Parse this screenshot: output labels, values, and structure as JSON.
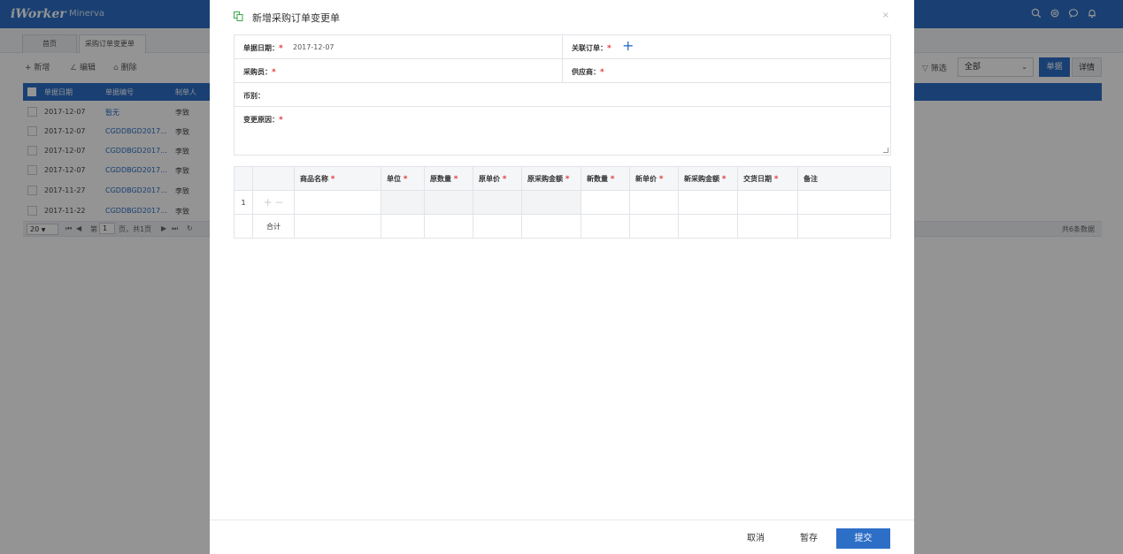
{
  "app": {
    "brand": "iWorker",
    "workspace": "Minerva"
  },
  "tabs": {
    "home": "首页",
    "active": "采购订单变更单",
    "close": "×"
  },
  "toolbar": {
    "add": "+ 新增",
    "edit": "编辑",
    "delete": "删除",
    "filter_label": "筛选",
    "filter_value": "全部",
    "view_list": "单据",
    "view_detail": "详情"
  },
  "grid": {
    "headers": [
      "单据日期",
      "单据编号",
      "制单人"
    ],
    "rows": [
      {
        "date": "2017-12-07",
        "no": "暂无",
        "user": "李致"
      },
      {
        "date": "2017-12-07",
        "no": "CGDDBGD2017...",
        "user": "李致"
      },
      {
        "date": "2017-12-07",
        "no": "CGDDBGD2017...",
        "user": "李致"
      },
      {
        "date": "2017-12-07",
        "no": "CGDDBGD2017...",
        "user": "李致"
      },
      {
        "date": "2017-11-27",
        "no": "CGDDBGD2017...",
        "user": "李致"
      },
      {
        "date": "2017-11-22",
        "no": "CGDDBGD2017...",
        "user": "李致"
      }
    ],
    "pager": {
      "size": "20",
      "page_prefix": "第",
      "page": "1",
      "page_suffix": "页，共1页",
      "total": "共6条数据"
    }
  },
  "modal": {
    "title": "新增采购订单变更单",
    "close": "×",
    "fields": {
      "date_label": "单据日期：",
      "date_value": "2017-12-07",
      "order_label": "关联订单：",
      "buyer_label": "采购员：",
      "supplier_label": "供应商：",
      "currency_label": "币别：",
      "reason_label": "变更原因："
    },
    "required_mark": "*",
    "table": {
      "headers": [
        {
          "label": "商品名称",
          "required": true
        },
        {
          "label": "单位",
          "required": true
        },
        {
          "label": "原数量",
          "required": true
        },
        {
          "label": "原单价",
          "required": true
        },
        {
          "label": "原采购金额",
          "required": true
        },
        {
          "label": "新数量",
          "required": true
        },
        {
          "label": "新单价",
          "required": true
        },
        {
          "label": "新采购金额",
          "required": true
        },
        {
          "label": "交货日期",
          "required": true
        },
        {
          "label": "备注",
          "required": false
        }
      ],
      "row_index": "1",
      "total_label": "合计"
    },
    "footer": {
      "cancel": "取消",
      "save": "暂存",
      "submit": "提交"
    }
  },
  "colors": {
    "primary": "#2d6fc7",
    "required": "#e23a3a",
    "overlay": "rgba(0,0,0,0.42)"
  }
}
